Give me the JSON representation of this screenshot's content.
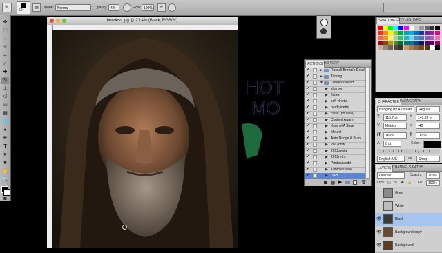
{
  "options_bar": {
    "brush_size": "60",
    "mode_label": "Mode:",
    "mode_value": "Normal",
    "opacity_label": "Opacity:",
    "opacity_value": "4%",
    "flow_label": "Flow:",
    "flow_value": "100%"
  },
  "document": {
    "title": "homless.jpg @ 21.4% (Black, RGB/8*)"
  },
  "swatches": {
    "tabs": [
      "SWATCHES",
      "STYLES",
      "INFO"
    ],
    "colors": [
      "#ff0000",
      "#ffff00",
      "#00ff00",
      "#00ffff",
      "#0000ff",
      "#ff00ff",
      "#ffffff",
      "#cccccc",
      "#999999",
      "#666666",
      "#333333",
      "#000000",
      "#ee3322",
      "#f58a1f",
      "#fff200",
      "#8dc63f",
      "#00a651",
      "#00a99d",
      "#00aeef",
      "#0072bc",
      "#2e3192",
      "#662d91",
      "#92278f",
      "#ec008c",
      "#f26c4f",
      "#f7941d",
      "#fff568",
      "#a3d39c",
      "#3cb878",
      "#1cbbb4",
      "#6dcff6",
      "#448ccb",
      "#5674b9",
      "#8560a8",
      "#a864a8",
      "#f06eaa",
      "#9e0b0f",
      "#a0410d",
      "#aba000",
      "#598527",
      "#007236",
      "#00746b",
      "#0076a3",
      "#004a80",
      "#1b1464",
      "#440e62",
      "#630460",
      "#9e005d",
      "#c7b299",
      "#998675",
      "#736357",
      "#534741",
      "#37302a",
      "#c69c6d",
      "#a67c52",
      "#8c6239",
      "#754c24",
      "#603913",
      "#ffffff",
      "#000000"
    ]
  },
  "actions": {
    "tabs": [
      "ACTIONS",
      "HISTORY"
    ],
    "items": [
      {
        "name": "Russell Brown's Detailin...",
        "checked": true,
        "type": "set"
      },
      {
        "name": "Taming",
        "checked": true,
        "type": "set"
      },
      {
        "name": "Derek's custom",
        "checked": true,
        "type": "set-open"
      },
      {
        "name": "sharpen",
        "checked": true,
        "type": "action"
      },
      {
        "name": "flatten",
        "checked": true,
        "type": "action"
      },
      {
        "name": "soft vinette",
        "checked": true,
        "type": "action"
      },
      {
        "name": "hard vinette",
        "checked": true,
        "type": "action"
      },
      {
        "name": "close (no save)",
        "checked": true,
        "type": "action"
      },
      {
        "name": "Content Aware",
        "checked": true,
        "type": "action"
      },
      {
        "name": "Kimmel A Save",
        "checked": true,
        "type": "action"
      },
      {
        "name": "Meurel",
        "checked": true,
        "type": "action"
      },
      {
        "name": "Auto Dodge & Burn",
        "checked": true,
        "type": "action"
      },
      {
        "name": "2012bnw",
        "checked": true,
        "type": "action"
      },
      {
        "name": "2012sepia",
        "checked": true,
        "type": "action"
      },
      {
        "name": "2012retro",
        "checked": true,
        "type": "action"
      },
      {
        "name": "Printpassedit",
        "checked": true,
        "type": "action"
      },
      {
        "name": "Kimmel2save",
        "checked": true,
        "type": "action"
      },
      {
        "name": "D&B",
        "checked": true,
        "type": "action",
        "selected": true
      }
    ]
  },
  "character": {
    "tabs": [
      "CHARACTER",
      "PARAGRAPH"
    ],
    "font_family": "Hanging By A Thread",
    "font_style": "Regular",
    "size": "115.7 pt",
    "leading": "147.33 pt",
    "kerning": "Metrics",
    "tracking": "-40",
    "vscale": "165%",
    "hscale": "161%",
    "baseline": "0 pt",
    "color_label": "Color:",
    "language": "English: UK",
    "antialias": "Sharp"
  },
  "layers": {
    "tabs": [
      "LAYERS",
      "CHANNELS",
      "PATHS"
    ],
    "blend_mode": "Overlay",
    "opacity_label": "Opacity:",
    "opacity_value": "100%",
    "lock_label": "Lock:",
    "fill_label": "Fill:",
    "fill_value": "100%",
    "items": [
      {
        "name": "Grey",
        "visible": false,
        "thumb": "#8a8a8a"
      },
      {
        "name": "White",
        "visible": false,
        "thumb": "#bbbbbb"
      },
      {
        "name": "Black",
        "visible": true,
        "thumb": "#3a3a3a",
        "selected": true
      },
      {
        "name": "Background copy",
        "visible": true,
        "thumb": "#6a4a2c"
      },
      {
        "name": "Background",
        "visible": true,
        "thumb": "#5a3e24"
      }
    ]
  }
}
